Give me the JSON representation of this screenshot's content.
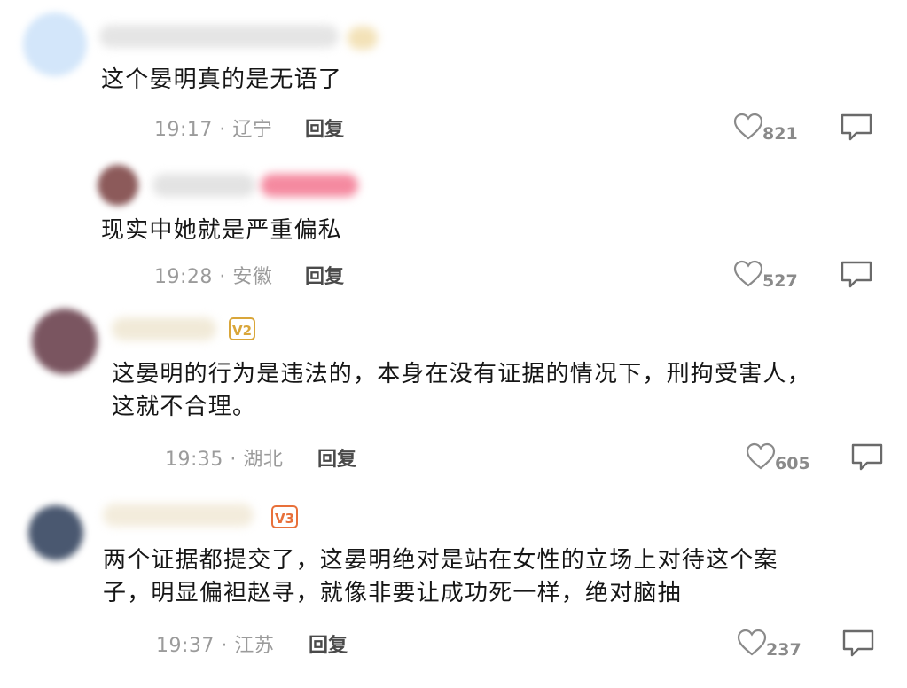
{
  "comments": [
    {
      "text_lines": [
        "这个晏明真的是无语了"
      ],
      "time": "19:17",
      "location": "辽宁",
      "reply_label": "回复",
      "likes": "821",
      "badge": "",
      "avatar_color": "#cfe3f8"
    },
    {
      "text_lines": [
        "现实中她就是严重偏私"
      ],
      "time": "19:28",
      "location": "安徽",
      "reply_label": "回复",
      "likes": "527",
      "badge": "",
      "avatar_color": "#8c5a5a"
    },
    {
      "text_lines": [
        "这晏明的行为是违法的，本身在没有证据的情况下，刑拘受害人，",
        "这就不合理。"
      ],
      "time": "19:35",
      "location": "湖北",
      "reply_label": "回复",
      "likes": "605",
      "badge": "V2",
      "avatar_color": "#7a5560"
    },
    {
      "text_lines": [
        "两个证据都提交了，这晏明绝对是站在女性的立场上对待这个案",
        "子，明显偏袒赵寻，就像非要让成功死一样，绝对脑抽"
      ],
      "time": "19:37",
      "location": "江苏",
      "reply_label": "回复",
      "likes": "237",
      "badge": "V3",
      "avatar_color": "#4a5870"
    }
  ],
  "meta_separator": "·",
  "colors": {
    "badge_v2": "#d9a63a",
    "badge_v3": "#e8703a",
    "name_blur_pink": "#f26d85"
  }
}
